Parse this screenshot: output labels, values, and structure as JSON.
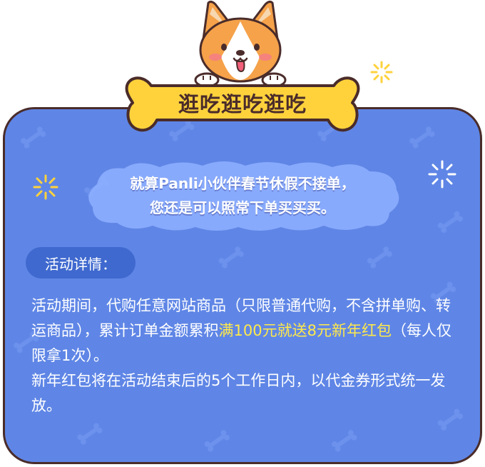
{
  "banner": {
    "title": "逛吃逛吃逛吃"
  },
  "notice": {
    "line1": "就算Panli小伙伴春节休假不接单，",
    "line2": "您还是可以照常下单买买买。"
  },
  "section": {
    "label": "活动详情："
  },
  "details": {
    "p1_a": "活动期间，代购任意网站商品（只限普通代购，不含拼单购、转运商品），累计订单金额累积",
    "p1_highlight": "满100元就送8元新年红包",
    "p1_b": "（每人仅限拿1次）。",
    "p2": "新年红包将在活动结束后的5个工作日内，以代金券形式统一发放。"
  },
  "colors": {
    "card_bg": "#5f86e6",
    "outline": "#4a2c2a",
    "bone": "#ffd23c",
    "highlight": "#ffe94a",
    "pill_bg": "#3f69cf",
    "cloud": "#8fb0ff"
  },
  "icons": [
    "corgi-mascot-icon",
    "bone-banner-icon",
    "sparkle-icon"
  ]
}
